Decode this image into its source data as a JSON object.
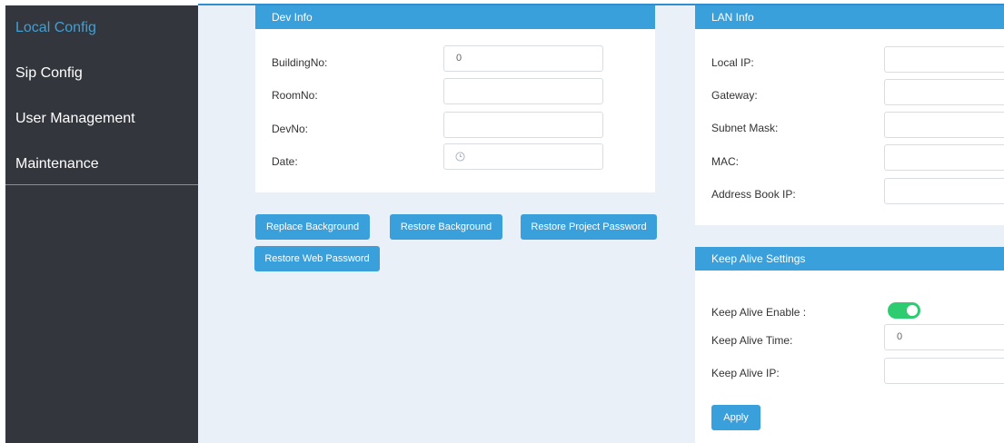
{
  "sidebar": {
    "items": [
      {
        "label": "Local Config",
        "active": true
      },
      {
        "label": "Sip Config",
        "active": false
      },
      {
        "label": "User Management",
        "active": false
      },
      {
        "label": "Maintenance",
        "active": false
      }
    ]
  },
  "dev_info": {
    "title": "Dev Info",
    "fields": [
      {
        "label": "BuildingNo:",
        "value": "0"
      },
      {
        "label": "RoomNo:",
        "value": ""
      },
      {
        "label": "DevNo:",
        "value": ""
      },
      {
        "label": "Date:",
        "value": ""
      }
    ],
    "date_icon": "clock-icon"
  },
  "actions": {
    "replace_background": "Replace Background",
    "restore_background": "Restore Background",
    "restore_project_password": "Restore Project Password",
    "restore_web_password": "Restore Web Password"
  },
  "lan_info": {
    "title": "LAN Info",
    "fields": [
      {
        "label": "Local IP:",
        "value": ""
      },
      {
        "label": "Gateway:",
        "value": ""
      },
      {
        "label": "Subnet Mask:",
        "value": ""
      },
      {
        "label": "MAC:",
        "value": ""
      },
      {
        "label": "Address Book IP:",
        "value": ""
      }
    ]
  },
  "keep_alive": {
    "title": "Keep Alive Settings",
    "enable_label": "Keep Alive Enable :",
    "enabled": true,
    "time_label": "Keep Alive Time:",
    "time_value": "0",
    "ip_label": "Keep Alive IP:",
    "ip_value": "",
    "apply_label": "Apply"
  },
  "colors": {
    "accent": "#3aa0dc",
    "sidebar_bg": "#33373d",
    "active_item": "#3f9fd6",
    "toggle_on": "#2ecc71",
    "content_bg": "#e9f0f8"
  }
}
